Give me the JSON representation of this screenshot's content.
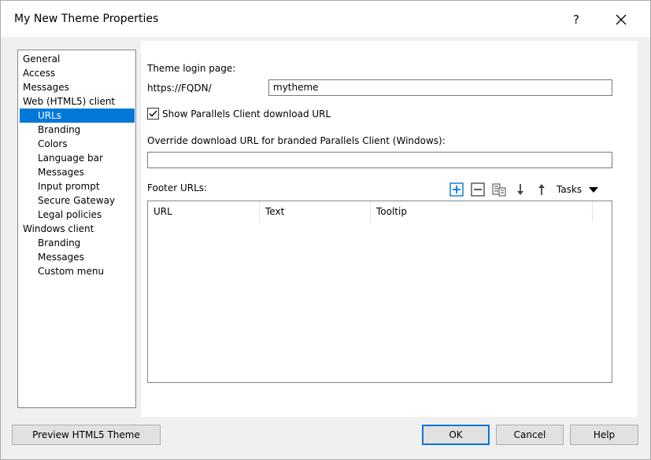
{
  "window": {
    "title": "My New Theme Properties",
    "help": "?"
  },
  "tree": {
    "items": [
      {
        "label": "General",
        "level": 0
      },
      {
        "label": "Access",
        "level": 0
      },
      {
        "label": "Messages",
        "level": 0
      },
      {
        "label": "Web (HTML5) client",
        "level": 0
      },
      {
        "label": "URLs",
        "level": 1,
        "selected": true
      },
      {
        "label": "Branding",
        "level": 1
      },
      {
        "label": "Colors",
        "level": 1
      },
      {
        "label": "Language bar",
        "level": 1
      },
      {
        "label": "Messages",
        "level": 1
      },
      {
        "label": "Input prompt",
        "level": 1
      },
      {
        "label": "Secure Gateway",
        "level": 1
      },
      {
        "label": "Legal policies",
        "level": 1
      },
      {
        "label": "Windows client",
        "level": 0
      },
      {
        "label": "Branding",
        "level": 1
      },
      {
        "label": "Messages",
        "level": 1
      },
      {
        "label": "Custom menu",
        "level": 1
      }
    ]
  },
  "content": {
    "login_page_label": "Theme login page:",
    "url_prefix": "https://FQDN/",
    "theme_path_value": "mytheme",
    "show_download_label": "Show Parallels Client download URL",
    "show_download_checked": true,
    "override_label": "Override download URL for branded Parallels Client (Windows):",
    "override_value": "",
    "footer_label": "Footer URLs:",
    "tasks_label": "Tasks",
    "columns": [
      "URL",
      "Text",
      "Tooltip"
    ],
    "accent_color": "#0078d7"
  },
  "buttons": {
    "preview": "Preview HTML5 Theme",
    "ok": "OK",
    "cancel": "Cancel",
    "help": "Help"
  }
}
